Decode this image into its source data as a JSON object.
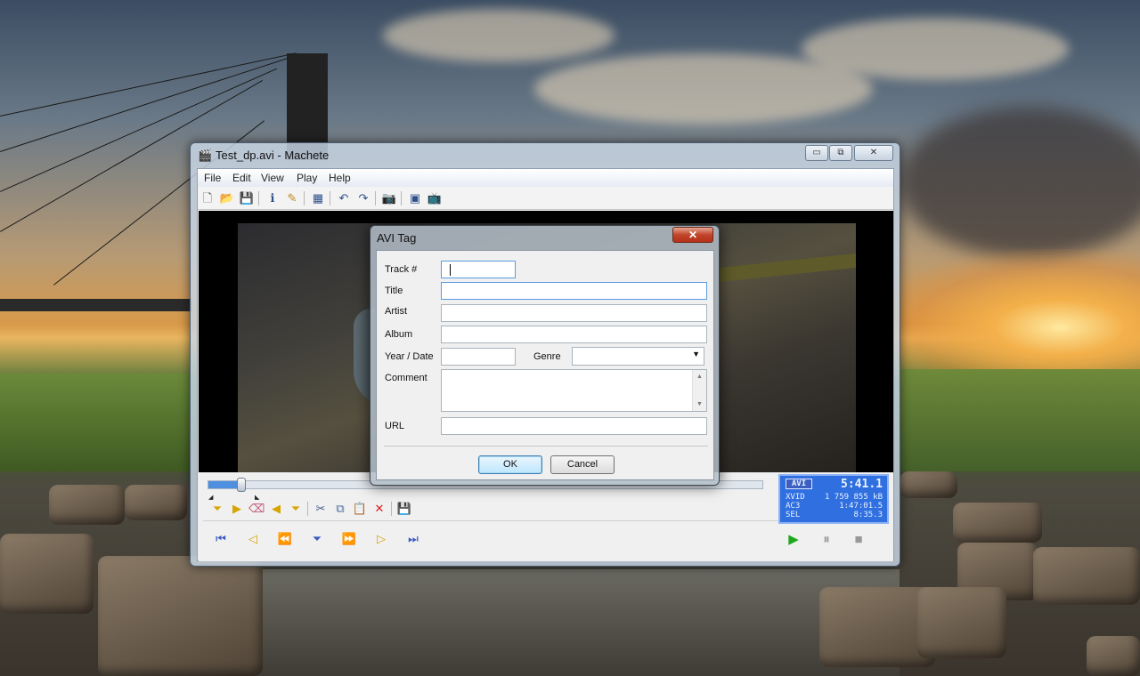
{
  "window": {
    "title": "Test_dp.avi - Machete",
    "minimize": "▭",
    "restore": "⧉",
    "close": "✕"
  },
  "menu": [
    "File",
    "Edit",
    "View",
    "Play",
    "Help"
  ],
  "toolbar_icons": [
    "new-file-icon",
    "open-folder-icon",
    "save-icon",
    "info-icon",
    "edit-tags-icon",
    "filmstrip-icon",
    "undo-icon",
    "redo-icon",
    "camera-icon",
    "frame-icon",
    "tv-icon"
  ],
  "seek": {
    "position_fraction": 0.06
  },
  "info_panel": {
    "container": "AVI",
    "duration": "5:41.1",
    "rows": [
      {
        "label": "XVID",
        "value": "1 759 855 kB"
      },
      {
        "label": "AC3",
        "value": "1:47:01.5"
      },
      {
        "label": "SEL",
        "value": "8:35.3"
      }
    ]
  },
  "dialog": {
    "title": "AVI Tag",
    "close": "✕",
    "labels": {
      "track": "Track #",
      "title": "Title",
      "artist": "Artist",
      "album": "Album",
      "year": "Year / Date",
      "genre": "Genre",
      "comment": "Comment",
      "url": "URL"
    },
    "values": {
      "track": "",
      "title": "",
      "artist": "",
      "album": "",
      "year": "",
      "genre": "",
      "comment": "",
      "url": ""
    },
    "ok": "OK",
    "cancel": "Cancel"
  }
}
